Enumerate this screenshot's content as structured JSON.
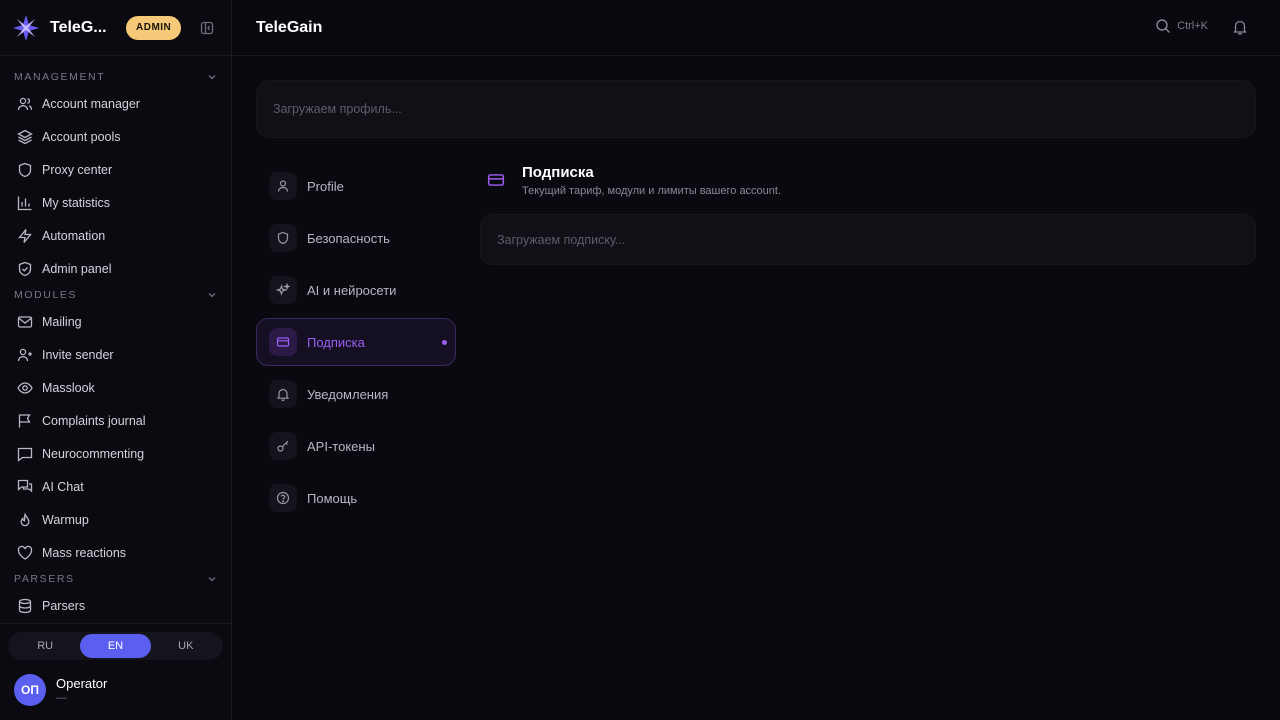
{
  "brand": {
    "name": "TeleG...",
    "badge": "ADMIN"
  },
  "sidebar": {
    "sections": [
      {
        "title": "MANAGEMENT",
        "items": [
          {
            "label": "Account manager",
            "icon": "users-icon"
          },
          {
            "label": "Account pools",
            "icon": "layers-icon"
          },
          {
            "label": "Proxy center",
            "icon": "shield-icon"
          },
          {
            "label": "My statistics",
            "icon": "bar-chart-icon"
          },
          {
            "label": "Automation",
            "icon": "bolt-icon"
          },
          {
            "label": "Admin panel",
            "icon": "shield-check-icon"
          }
        ]
      },
      {
        "title": "MODULES",
        "items": [
          {
            "label": "Mailing",
            "icon": "mail-icon"
          },
          {
            "label": "Invite sender",
            "icon": "user-plus-icon"
          },
          {
            "label": "Masslook",
            "icon": "eye-icon"
          },
          {
            "label": "Complaints journal",
            "icon": "flag-icon"
          },
          {
            "label": "Neurocommenting",
            "icon": "message-square-icon"
          },
          {
            "label": "AI Chat",
            "icon": "messages-icon"
          },
          {
            "label": "Warmup",
            "icon": "flame-icon"
          },
          {
            "label": "Mass reactions",
            "icon": "heart-icon"
          }
        ]
      },
      {
        "title": "PARSERS",
        "items": [
          {
            "label": "Parsers",
            "icon": "database-icon"
          }
        ]
      }
    ],
    "languages": [
      "RU",
      "EN",
      "UK"
    ],
    "active_language": "EN",
    "user": {
      "initials": "ОП",
      "name": "Operator",
      "sub": "—"
    }
  },
  "topbar": {
    "title": "TeleGain",
    "search_shortcut": "Ctrl+K"
  },
  "main": {
    "profile_loading": "Загружаем профиль...",
    "settings_nav": [
      {
        "label": "Profile",
        "icon": "user-icon"
      },
      {
        "label": "Безопасность",
        "icon": "shield-icon"
      },
      {
        "label": "AI и нейросети",
        "icon": "sparkles-icon"
      },
      {
        "label": "Подписка",
        "icon": "credit-card-icon"
      },
      {
        "label": "Уведомления",
        "icon": "bell-icon"
      },
      {
        "label": "API-токены",
        "icon": "key-icon"
      },
      {
        "label": "Помощь",
        "icon": "help-circle-icon"
      }
    ],
    "active_setting": "Подписка",
    "section": {
      "title": "Подписка",
      "subtitle": "Текущий тариф, модули и лимиты вашего account.",
      "loading": "Загружаем подписку..."
    }
  },
  "colors": {
    "accent": "#5b5ff0",
    "purple": "#9b5df3",
    "badge": "#f6c978",
    "bg": "#0a0910"
  }
}
